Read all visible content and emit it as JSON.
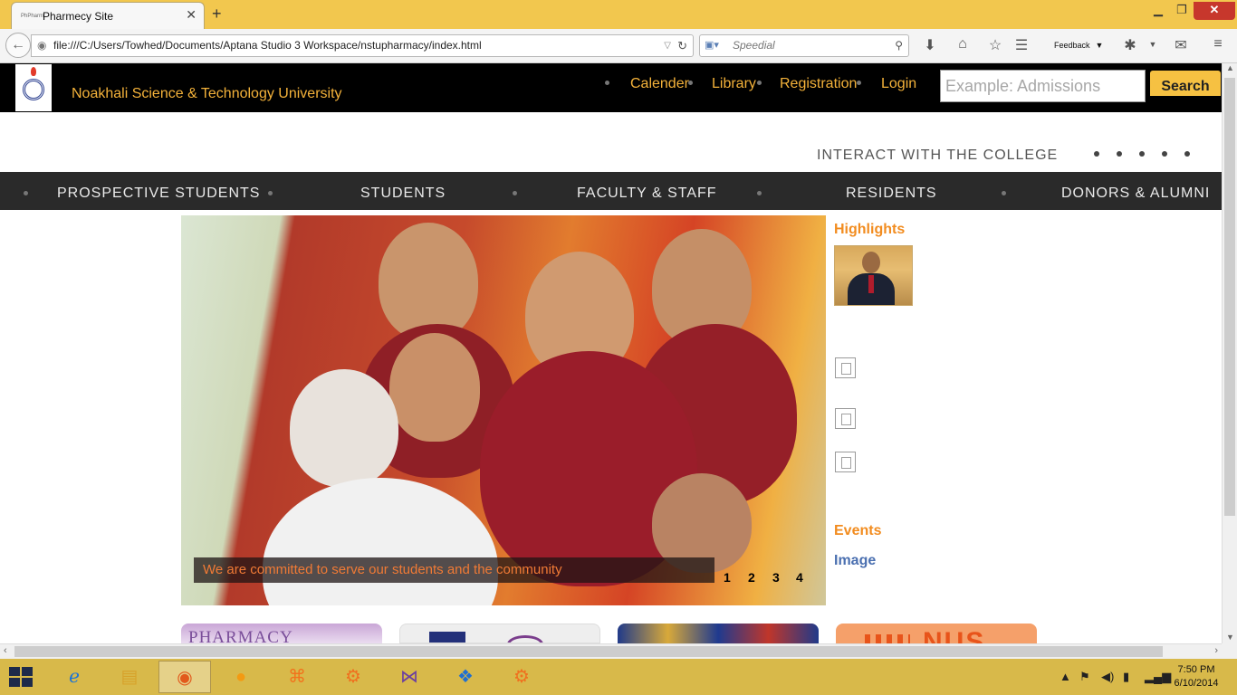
{
  "browser": {
    "tab_title": "Pharmecy Site",
    "tab_favicon_text": "PhPharm",
    "new_tab": "+",
    "url": "file:///C:/Users/Towhed/Documents/Aptana Studio 3 Workspace/nstupharmacy/index.html",
    "search_placeholder": "Speedial",
    "feedback_label": "Feedback"
  },
  "header": {
    "university_name": "Noakhali Science & Technology University",
    "top_links": [
      "Calender",
      "Library",
      "Registration",
      "Login"
    ],
    "search_placeholder": "Example: Admissions",
    "search_button": "Search"
  },
  "interact_text": "INTERACT WITH THE COLLEGE",
  "main_nav": [
    "PROSPECTIVE STUDENTS",
    "STUDENTS",
    "FACULTY & STAFF",
    "RESIDENTS",
    "DONORS & ALUMNI"
  ],
  "slider": {
    "caption": "We are committed to serve our students and the community",
    "pages": [
      "1",
      "2",
      "3",
      "4"
    ]
  },
  "sidebar": {
    "highlights_heading": "Highlights",
    "events_heading": "Events",
    "image_link": "Image"
  },
  "tiles": {
    "tile1_text": "PHARMACY",
    "tile4_text": "NUS"
  },
  "taskbar": {
    "time": "7:50 PM",
    "date": "6/10/2014"
  },
  "colors": {
    "accent_orange": "#f4b23a",
    "highlight_orange": "#f28c1f",
    "link_blue": "#4a6fb0",
    "header_bg": "#000000",
    "nav_bg": "#2a2a2a",
    "taskbar": "#d8b94a"
  }
}
